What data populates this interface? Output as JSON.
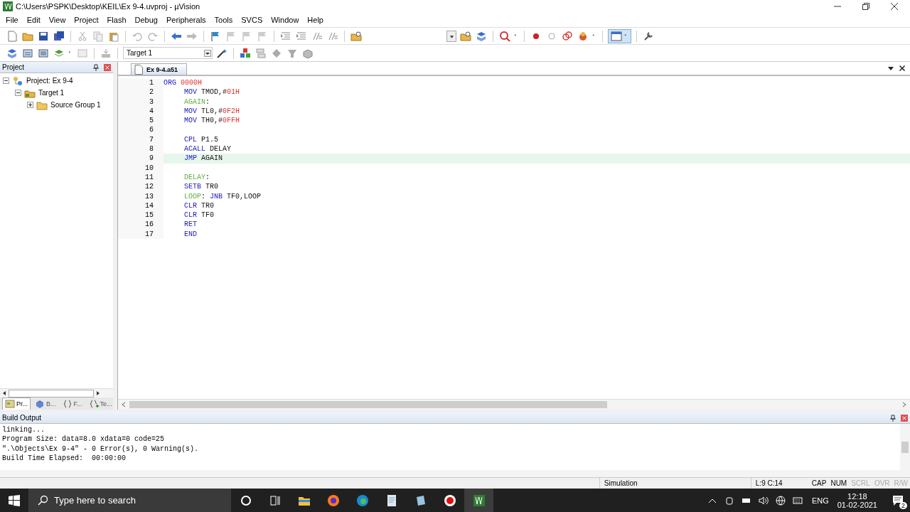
{
  "window": {
    "title": "C:\\Users\\PSPK\\Desktop\\KEIL\\Ex 9-4.uvproj - µVision"
  },
  "menu": [
    "File",
    "Edit",
    "View",
    "Project",
    "Flash",
    "Debug",
    "Peripherals",
    "Tools",
    "SVCS",
    "Window",
    "Help"
  ],
  "target_select": {
    "value": "Target 1"
  },
  "project_panel": {
    "title": "Project",
    "tree": [
      {
        "label": "Project: Ex 9-4",
        "expanded": true,
        "children": [
          {
            "label": "Target 1",
            "expanded": true,
            "children": [
              {
                "label": "Source Group 1",
                "expanded": false
              }
            ]
          }
        ]
      }
    ],
    "tabs": [
      {
        "label": "Pr...",
        "selected": true
      },
      {
        "label": "B...",
        "selected": false
      },
      {
        "label": "F...",
        "selected": false
      },
      {
        "label": "Te...",
        "selected": false
      }
    ]
  },
  "editor": {
    "tabs": [
      {
        "label": "Ex 9-4.a51",
        "selected": true
      }
    ],
    "lines": [
      {
        "number": "1",
        "indent": false,
        "current": false,
        "tokens": [
          {
            "text": "ORG",
            "kind": "keyword"
          },
          {
            "text": " 0000H",
            "kind": "number"
          }
        ]
      },
      {
        "number": "2",
        "indent": true,
        "current": false,
        "tokens": [
          {
            "text": "MOV",
            "kind": "keyword"
          },
          {
            "text": " TMOD,#",
            "kind": "plain"
          },
          {
            "text": "01H",
            "kind": "number"
          }
        ]
      },
      {
        "number": "3",
        "indent": true,
        "current": false,
        "tokens": [
          {
            "text": "AGAIN",
            "kind": "label"
          },
          {
            "text": ":",
            "kind": "plain"
          }
        ]
      },
      {
        "number": "4",
        "indent": true,
        "current": false,
        "tokens": [
          {
            "text": "MOV",
            "kind": "keyword"
          },
          {
            "text": " TL0,#",
            "kind": "plain"
          },
          {
            "text": "0F2H",
            "kind": "number"
          }
        ]
      },
      {
        "number": "5",
        "indent": true,
        "current": false,
        "tokens": [
          {
            "text": "MOV",
            "kind": "keyword"
          },
          {
            "text": " TH0,#",
            "kind": "plain"
          },
          {
            "text": "0FFH",
            "kind": "number"
          }
        ]
      },
      {
        "number": "6",
        "current": false
      },
      {
        "number": "7",
        "indent": true,
        "current": false,
        "tokens": [
          {
            "text": "CPL",
            "kind": "keyword"
          },
          {
            "text": " P1.5",
            "kind": "plain"
          }
        ]
      },
      {
        "number": "8",
        "indent": true,
        "current": false,
        "tokens": [
          {
            "text": "ACALL",
            "kind": "keyword"
          },
          {
            "text": " DELAY",
            "kind": "plain"
          }
        ]
      },
      {
        "number": "9",
        "indent": true,
        "current": true,
        "tokens": [
          {
            "text": "JMP",
            "kind": "keyword"
          },
          {
            "text": " AGAIN",
            "kind": "plain"
          }
        ]
      },
      {
        "number": "10",
        "current": false
      },
      {
        "number": "11",
        "indent": true,
        "current": false,
        "tokens": [
          {
            "text": "DELAY",
            "kind": "label"
          },
          {
            "text": ":",
            "kind": "plain"
          }
        ]
      },
      {
        "number": "12",
        "indent": true,
        "current": false,
        "tokens": [
          {
            "text": "SETB",
            "kind": "keyword"
          },
          {
            "text": " TR0",
            "kind": "plain"
          }
        ]
      },
      {
        "number": "13",
        "indent": true,
        "current": false,
        "tokens": [
          {
            "text": "LOOP",
            "kind": "label"
          },
          {
            "text": ": ",
            "kind": "plain"
          },
          {
            "text": "JNB",
            "kind": "keyword"
          },
          {
            "text": " TF0,LOOP",
            "kind": "plain"
          }
        ]
      },
      {
        "number": "14",
        "indent": true,
        "current": false,
        "tokens": [
          {
            "text": "CLR",
            "kind": "keyword"
          },
          {
            "text": " TR0",
            "kind": "plain"
          }
        ]
      },
      {
        "number": "15",
        "indent": true,
        "current": false,
        "tokens": [
          {
            "text": "CLR",
            "kind": "keyword"
          },
          {
            "text": " TF0",
            "kind": "plain"
          }
        ]
      },
      {
        "number": "16",
        "indent": true,
        "current": false,
        "tokens": [
          {
            "text": "RET",
            "kind": "keyword"
          }
        ]
      },
      {
        "number": "17",
        "indent": true,
        "current": false,
        "tokens": [
          {
            "text": "END",
            "kind": "keyword"
          }
        ]
      }
    ]
  },
  "build_output": {
    "title": "Build Output",
    "lines": [
      "linking...",
      "Program Size: data=8.0 xdata=0 code=25",
      "\".\\Objects\\Ex 9-4\" - 0 Error(s), 0 Warning(s).",
      "Build Time Elapsed:  00:00:00"
    ]
  },
  "status_bar": {
    "mode": "Simulation",
    "position": "L:9 C:14",
    "indicators": [
      {
        "label": "CAP",
        "on": true
      },
      {
        "label": "NUM",
        "on": true
      },
      {
        "label": "SCRL",
        "on": false
      },
      {
        "label": "OVR",
        "on": false
      },
      {
        "label": "R/W",
        "on": false
      }
    ]
  },
  "taskbar": {
    "search": {
      "placeholder": "Type here to search"
    },
    "language": "ENG",
    "time": "12:18",
    "date": "01-02-2021",
    "notifications": "2"
  }
}
